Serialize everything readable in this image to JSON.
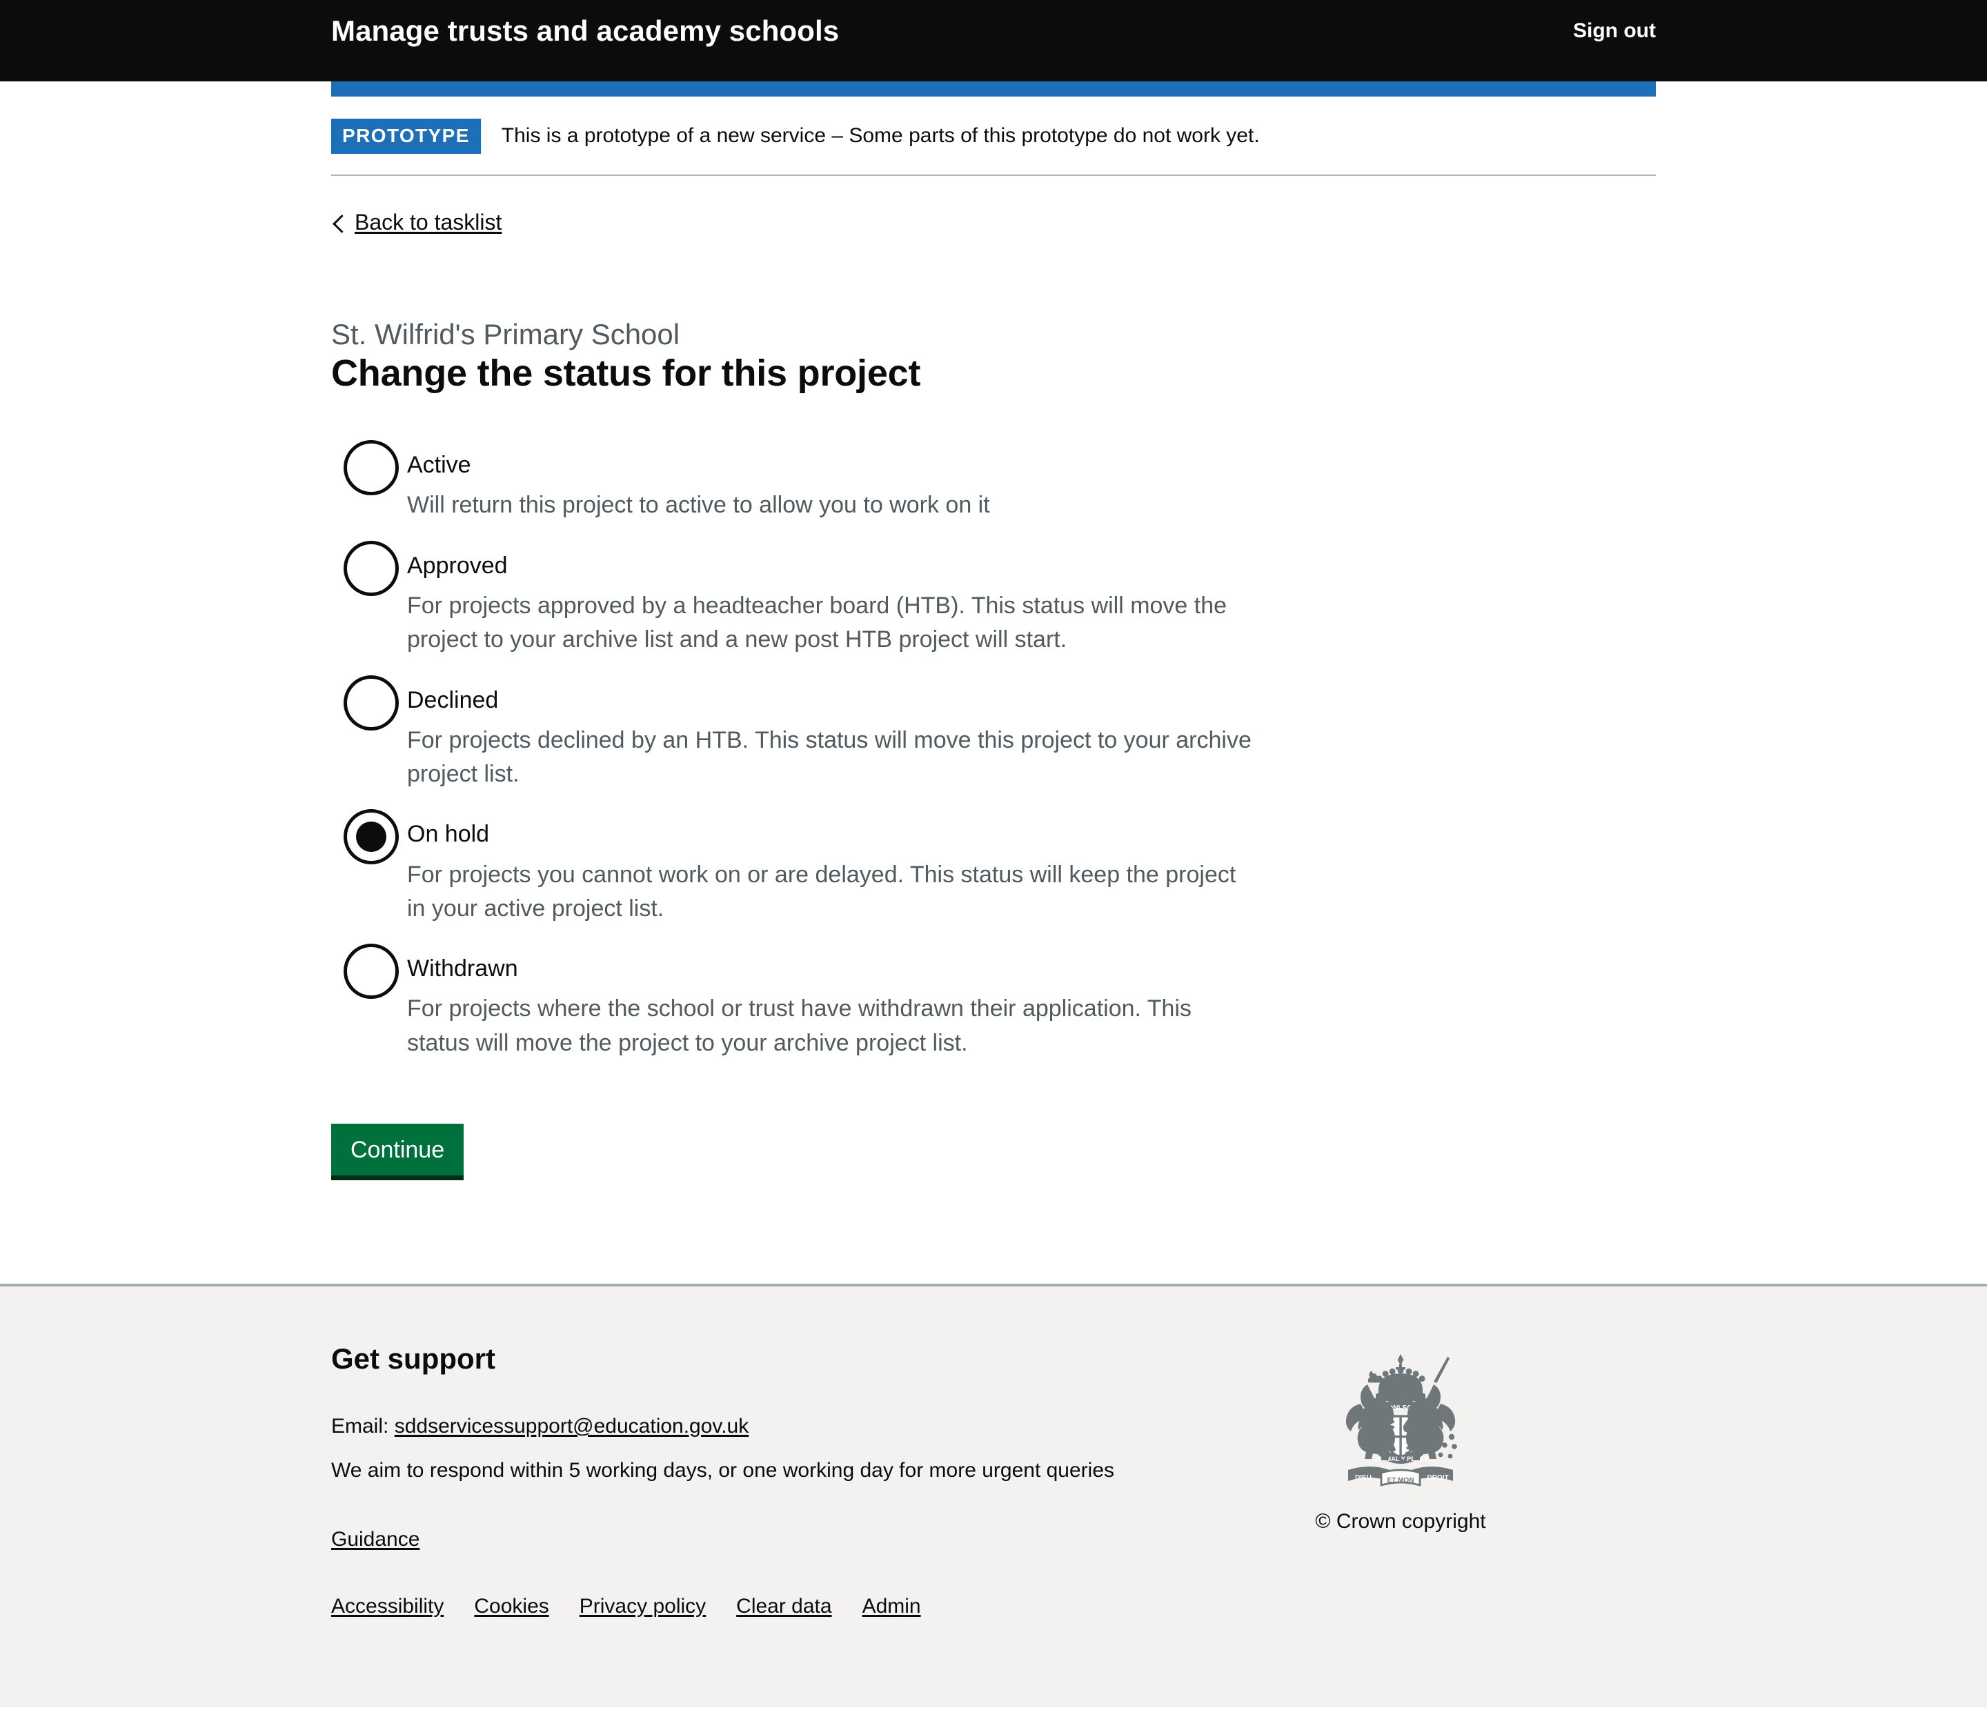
{
  "header": {
    "service_name": "Manage trusts and academy schools",
    "sign_out_label": "Sign out"
  },
  "phase_banner": {
    "tag": "PROTOTYPE",
    "text": "This is a prototype of a new service – Some parts of this prototype do not work yet."
  },
  "back_link": {
    "label": "Back to tasklist"
  },
  "main": {
    "caption": "St. Wilfrid's Primary School",
    "heading": "Change the status for this project",
    "continue_label": "Continue",
    "selected_value": "On hold",
    "options": [
      {
        "label": "Active",
        "hint": "Will return this project to active to allow you to work on it",
        "checked": false
      },
      {
        "label": "Approved",
        "hint": "For projects approved by a headteacher board (HTB). This status will move the project to your archive list and a new post HTB project will start.",
        "checked": false
      },
      {
        "label": "Declined",
        "hint": "For projects declined by an HTB. This status will move this project to your archive project list.",
        "checked": false
      },
      {
        "label": "On hold",
        "hint": "For projects you cannot work on or are delayed. This status will keep the project in your active project list.",
        "checked": true
      },
      {
        "label": "Withdrawn",
        "hint": "For projects where the school or trust have withdrawn their application. This status will move the project to your archive project list.",
        "checked": false
      }
    ]
  },
  "footer": {
    "heading": "Get support",
    "email_prefix": "Email:",
    "email_address": "sddservicessupport@education.gov.uk",
    "response_text": "We aim to respond within 5 working days, or one working day for more urgent queries",
    "guidance_label": "Guidance",
    "links": [
      {
        "label": "Accessibility"
      },
      {
        "label": "Cookies"
      },
      {
        "label": "Privacy policy"
      },
      {
        "label": "Clear data"
      },
      {
        "label": "Admin"
      }
    ],
    "crown_caption": "© Crown copyright"
  },
  "colors": {
    "header_black": "#0b0c0c",
    "govuk_blue": "#1d70b8",
    "button_green": "#00703c",
    "button_green_shadow": "#002d18",
    "footer_grey": "#f3f2f1",
    "secondary_text": "#505a5f",
    "border_grey": "#b1b4b6"
  }
}
